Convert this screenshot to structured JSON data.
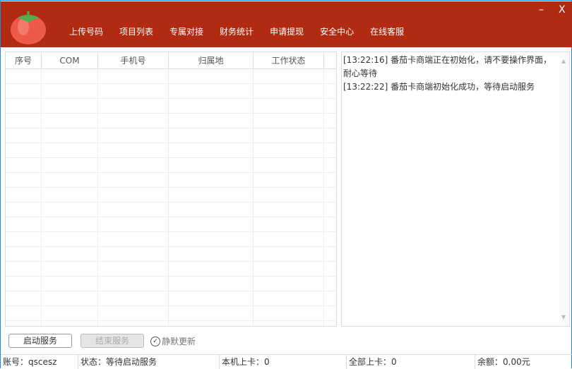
{
  "header": {
    "nav": [
      "上传号码",
      "项目列表",
      "专属对接",
      "财务统计",
      "申请提现",
      "安全中心",
      "在线客服"
    ],
    "minimize": "–",
    "close": "X"
  },
  "table": {
    "columns": [
      "序号",
      "COM",
      "手机号",
      "归属地",
      "工作状态",
      ""
    ],
    "rows": []
  },
  "log": [
    "[13:22:16] 番茄卡商端正在初始化，请不要操作界面，耐心等待",
    "[13:22:22] 番茄卡商端初始化成功，等待启动服务"
  ],
  "buttons": {
    "start": "启动服务",
    "stop": "结束服务",
    "silent_update": "静默更新",
    "silent_checked": true
  },
  "status": {
    "account": "账号：qscesz",
    "state": "状态：等待启动服务",
    "local": "本机上卡：0",
    "all": "全部上卡：0",
    "balance": "余额：0.00元"
  },
  "colors": {
    "header": "#b12a12"
  }
}
